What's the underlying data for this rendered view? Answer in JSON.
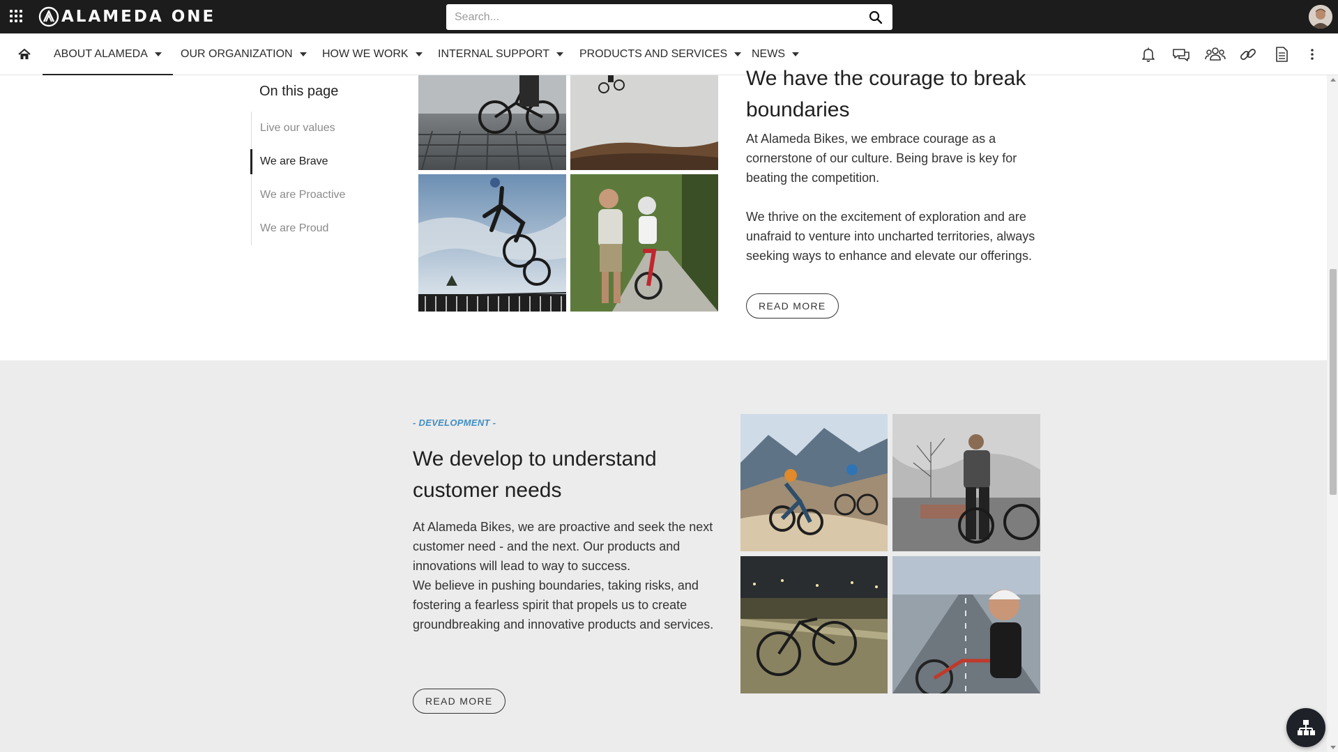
{
  "header": {
    "logo_text": "ALAMEDA ONE",
    "search_placeholder": "Search..."
  },
  "nav": {
    "items": [
      {
        "label": "ABOUT ALAMEDA",
        "active": true
      },
      {
        "label": "OUR ORGANIZATION"
      },
      {
        "label": "HOW WE WORK"
      },
      {
        "label": "INTERNAL SUPPORT"
      },
      {
        "label": "PRODUCTS AND SERVICES"
      },
      {
        "label": "NEWS"
      }
    ],
    "utility_icons": [
      "bell-icon",
      "chat-icon",
      "people-icon",
      "link-icon",
      "document-icon",
      "more-vertical-icon"
    ]
  },
  "toc": {
    "title": "On this page",
    "items": [
      {
        "label": "Live our values"
      },
      {
        "label": "We are Brave",
        "active": true
      },
      {
        "label": "We are Proactive"
      },
      {
        "label": "We are Proud"
      }
    ]
  },
  "brave": {
    "heading_line1": "We have the courage to break",
    "heading_line2": "boundaries",
    "paragraph1": "At Alameda Bikes, we embrace courage as a cornerstone of our culture. Being brave is key for beating the competition.",
    "paragraph2": "We thrive on the excitement of exploration and are unafraid to venture into uncharted territories, always seeking ways to enhance and elevate our offerings.",
    "button": "READ MORE"
  },
  "development": {
    "eyebrow": "- DEVELOPMENT -",
    "heading": "We develop to understand customer needs",
    "paragraph1": "At Alameda Bikes, we are proactive and seek the next customer need - and the next. Our products and innovations will lead to way to success.",
    "paragraph2": "We believe in pushing boundaries, taking risks, and fostering a fearless spirit that propels us to create groundbreaking and innovative products and services.",
    "button": "READ MORE"
  },
  "colors": {
    "topbar": "#1c1c1c",
    "accent_eyebrow": "#3f8ec4",
    "section_gray": "#ececec"
  }
}
